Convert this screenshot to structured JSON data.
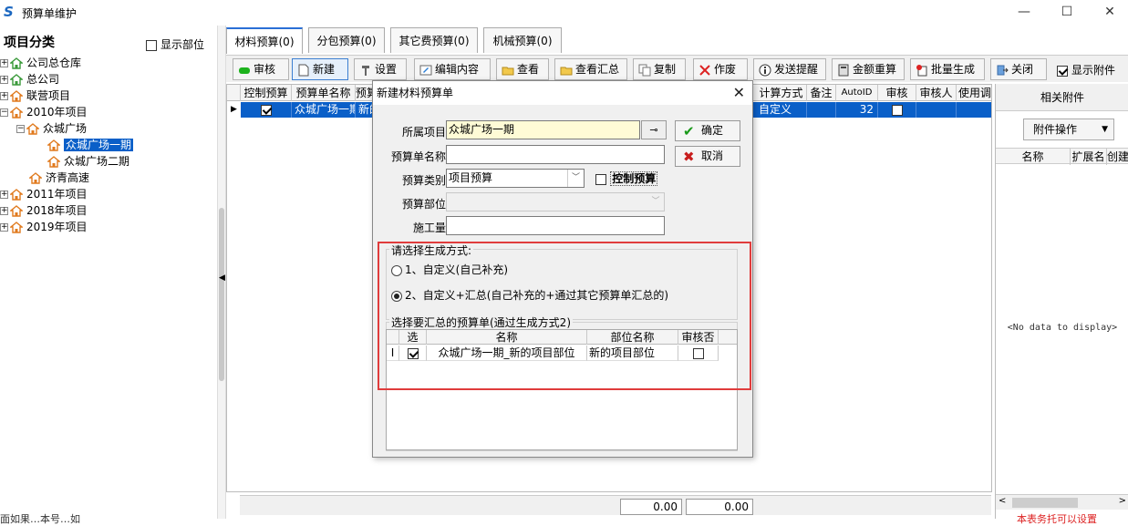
{
  "window": {
    "title": "预算单维护",
    "minimize": "—",
    "maximize": "☐",
    "close": "✕"
  },
  "left": {
    "header": "项目分类",
    "show_dept_label": "显示部位",
    "tree": [
      {
        "label": "公司总仓库",
        "expander": "+"
      },
      {
        "label": "总公司",
        "expander": "+"
      },
      {
        "label": "联营项目",
        "expander": "+"
      },
      {
        "label": "2010年项目",
        "expander": "−"
      },
      {
        "label": "众城广场",
        "expander": "−"
      },
      {
        "label": "众城广场一期",
        "expander": ""
      },
      {
        "label": "众城广场二期",
        "expander": ""
      },
      {
        "label": "济青高速",
        "expander": ""
      },
      {
        "label": "2011年项目",
        "expander": "+"
      },
      {
        "label": "2018年项目",
        "expander": "+"
      },
      {
        "label": "2019年项目",
        "expander": "+"
      }
    ]
  },
  "tabs": [
    {
      "label": "材料预算(0)"
    },
    {
      "label": "分包预算(0)"
    },
    {
      "label": "其它费预算(0)"
    },
    {
      "label": "机械预算(0)"
    }
  ],
  "toolbar": {
    "audit": "审核",
    "new": "新建",
    "settings": "设置",
    "edit_content": "编辑内容",
    "view": "查看",
    "view_summary": "查看汇总",
    "copy": "复制",
    "void": "作废",
    "send_reminder": "发送提醒",
    "recalc_amount": "金额重算",
    "batch_generate": "批量生成",
    "close": "关闭",
    "show_attachments": "显示附件"
  },
  "grid": {
    "columns": [
      "控制预算",
      "预算单名称",
      "预算",
      "计算方式",
      "备注",
      "AutoID",
      "审核",
      "审核人",
      "使用调"
    ],
    "row": {
      "control": true,
      "name": "众城广场一期",
      "type": "新的",
      "calc": "自定义",
      "remark": "",
      "autoid": "32",
      "audit": false,
      "auditor": ""
    }
  },
  "totals": [
    "0.00",
    "0.00"
  ],
  "attach": {
    "title": "相关附件",
    "op_button": "附件操作",
    "columns": [
      "名称",
      "扩展名",
      "创建"
    ],
    "no_data": "<No data to display>"
  },
  "status": {
    "left": "面如果…本号…如",
    "right": "本表务托可以设置"
  },
  "dialog": {
    "title": "新建材料预算单",
    "project_label": "所属项目:",
    "project_value": "众城广场一期",
    "name_label": "预算单名称:",
    "name_value": "",
    "type_label": "预算类别:",
    "type_value": "项目预算",
    "control_label": "控制预算",
    "dept_label": "预算部位:",
    "dept_value": "",
    "qty_label": "施工量:",
    "qty_value": "",
    "ok": "确定",
    "cancel": "取消",
    "gen_group": "请选择生成方式:",
    "opt1": "1、自定义(自己补充)",
    "opt2": "2、自定义+汇总(自己补充的+通过其它预算单汇总的)",
    "sel_group": "选择要汇总的预算单(通过生成方式2)",
    "sub_columns": [
      "选",
      "名称",
      "部位名称",
      "审核否"
    ],
    "sub_row": {
      "indicator": "I",
      "selected": true,
      "name": "众城广场一期_新的项目部位",
      "dept": "新的项目部位",
      "audited": false
    }
  }
}
